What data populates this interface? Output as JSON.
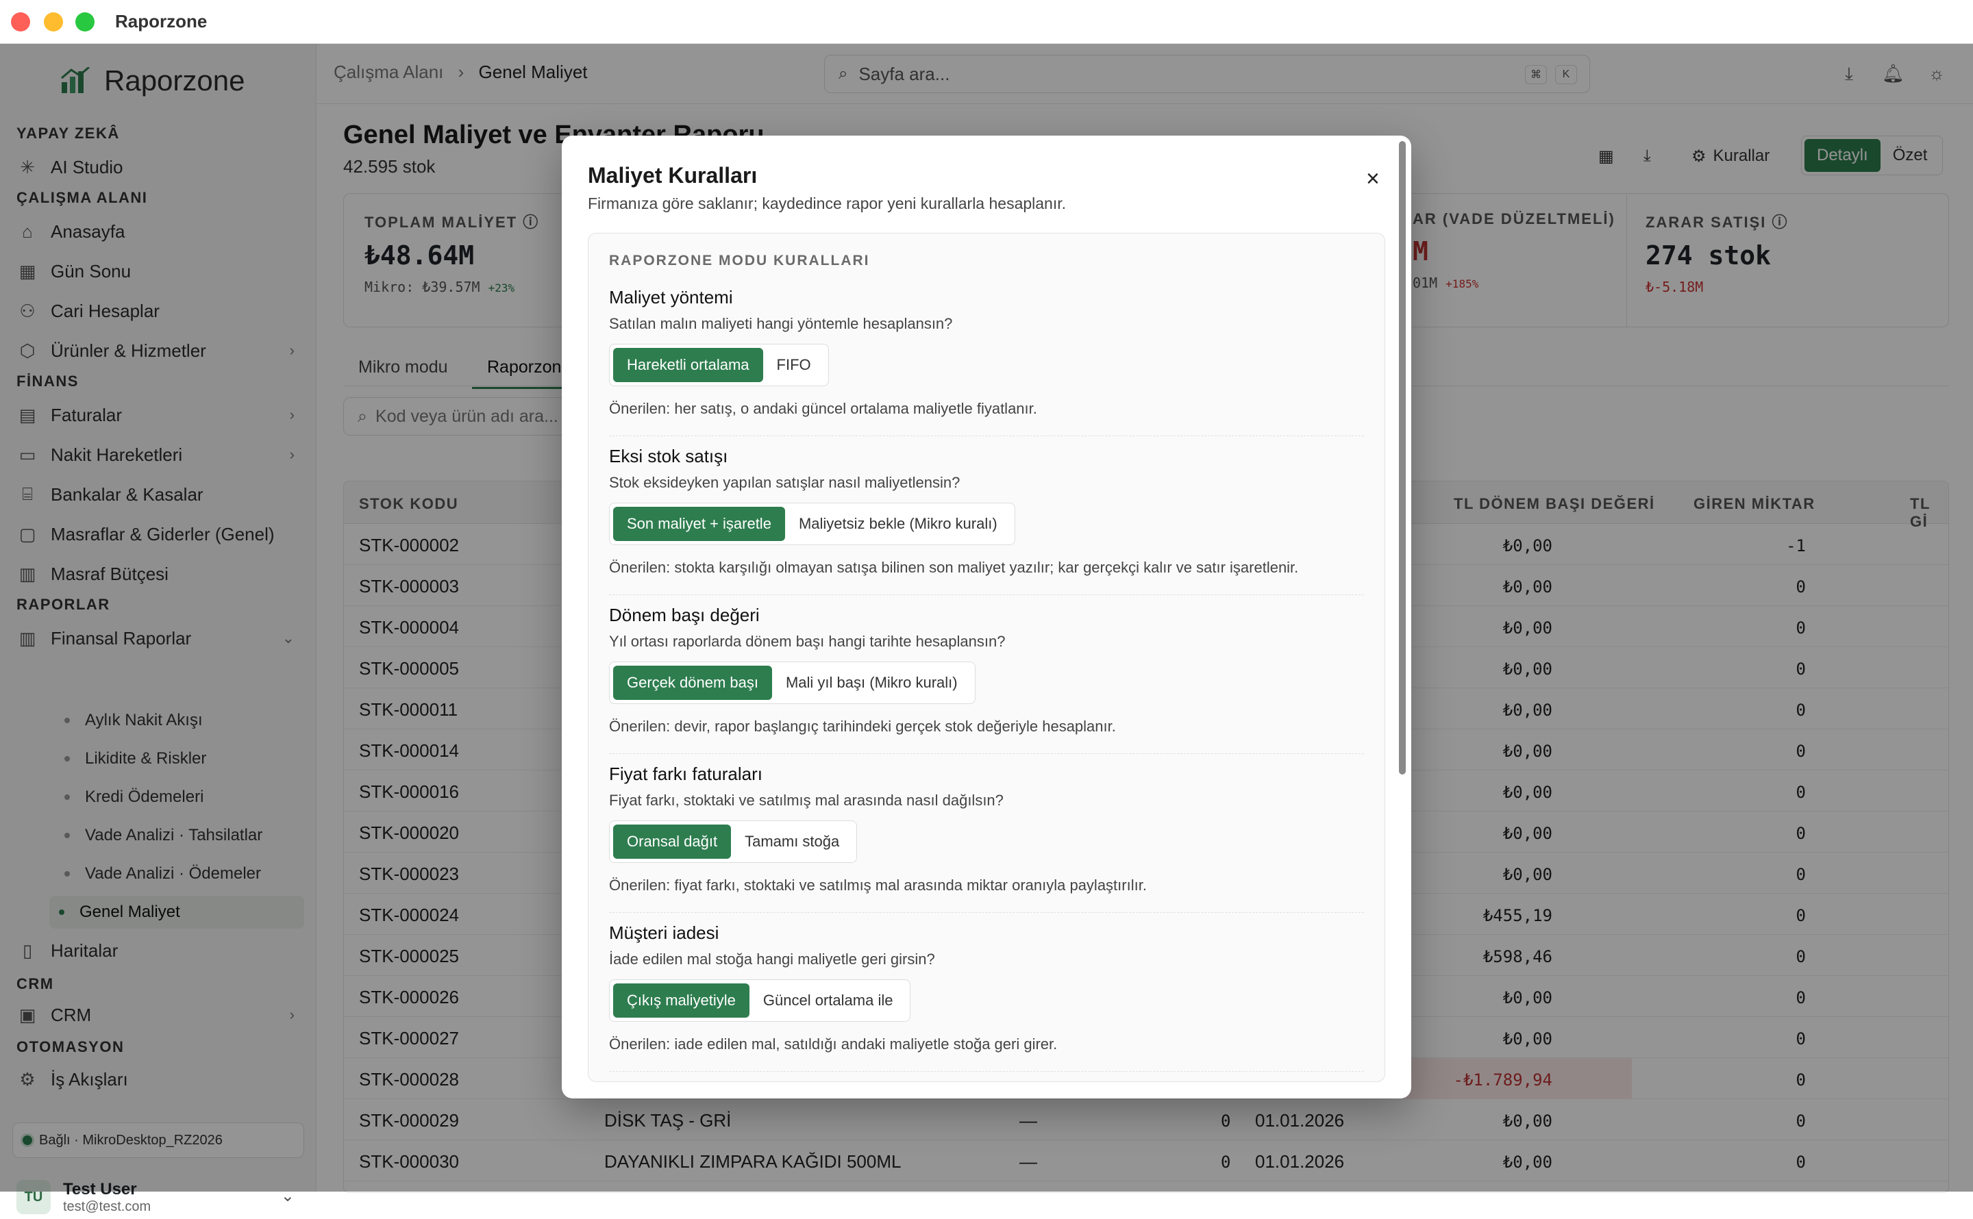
{
  "app": {
    "window_title": "Raporzone",
    "brand": "Raporzone"
  },
  "sidebar": {
    "sections": {
      "ai": "YAPAY ZEKÂ",
      "workspace": "ÇALIŞMA ALANI",
      "finance": "FİNANS",
      "reports": "RAPORLAR",
      "crm": "CRM",
      "automation": "OTOMASYON"
    },
    "items": {
      "ai_studio": "AI Studio",
      "home": "Anasayfa",
      "day_end": "Gün Sonu",
      "accounts": "Cari Hesaplar",
      "products": "Ürünler & Hizmetler",
      "invoices": "Faturalar",
      "cash_moves": "Nakit Hareketleri",
      "banks": "Bankalar & Kasalar",
      "expenses": "Masraflar & Giderler (Genel)",
      "budget": "Masraf Bütçesi",
      "fin_reports": "Finansal Raporlar",
      "maps": "Haritalar",
      "crm": "CRM",
      "workflows": "İş Akışları"
    },
    "subitems": [
      "Aylık Nakit Akışı",
      "Likidite & Riskler",
      "Kredi Ödemeleri",
      "Vade Analizi · Tahsilatlar",
      "Vade Analizi · Ödemeler",
      "Genel Maliyet"
    ],
    "connection": "Bağlı · MikroDesktop_RZ2026",
    "user": {
      "initials": "TU",
      "name": "Test User",
      "email": "test@test.com"
    }
  },
  "topbar": {
    "breadcrumb_root": "Çalışma Alanı",
    "breadcrumb_sep": "›",
    "breadcrumb_current": "Genel Maliyet",
    "search_placeholder": "Sayfa ara...",
    "kbd1": "⌘",
    "kbd2": "K"
  },
  "page": {
    "title": "Genel Maliyet ve Envanter Raporu",
    "subtitle": "42.595 stok",
    "rules_btn": "Kurallar",
    "view_detail": "Detaylı",
    "view_summary": "Özet",
    "cards": {
      "total_cost_label": "TOPLAM MALİYET",
      "total_cost_value": "₺48.64M",
      "total_cost_sub": "Mikro: ₺39.57M",
      "total_cost_delta": "+23%",
      "mid_label": "AR (VADE DÜZELTMELİ)",
      "mid_value": "M",
      "mid_sub": "01M",
      "mid_delta": "+185%",
      "loss_label": "ZARAR SATIŞI",
      "loss_value": "274 stok",
      "loss_sub": "₺-5.18M"
    },
    "tabs": [
      "Mikro modu",
      "Raporzone"
    ],
    "filter_placeholder": "Kod veya ürün adı ara..."
  },
  "table": {
    "headers": {
      "code": "STOK KODU",
      "opening": "TL DÖNEM BAŞI DEĞERİ",
      "in_qty": "GİREN MİKTAR",
      "tl_gi": "TL Gİ"
    },
    "rows": [
      {
        "code": "STK-000002",
        "name": "",
        "dash": "",
        "qty": "",
        "date": "",
        "opening": "₺0,00",
        "in": "-1"
      },
      {
        "code": "STK-000003",
        "name": "",
        "dash": "",
        "qty": "",
        "date": "",
        "opening": "₺0,00",
        "in": "0"
      },
      {
        "code": "STK-000004",
        "name": "",
        "dash": "",
        "qty": "",
        "date": "",
        "opening": "₺0,00",
        "in": "0"
      },
      {
        "code": "STK-000005",
        "name": "",
        "dash": "",
        "qty": "",
        "date": "",
        "opening": "₺0,00",
        "in": "0"
      },
      {
        "code": "STK-000011",
        "name": "",
        "dash": "",
        "qty": "",
        "date": "",
        "opening": "₺0,00",
        "in": "0"
      },
      {
        "code": "STK-000014",
        "name": "",
        "dash": "",
        "qty": "",
        "date": "",
        "opening": "₺0,00",
        "in": "0"
      },
      {
        "code": "STK-000016",
        "name": "",
        "dash": "",
        "qty": "",
        "date": "",
        "opening": "₺0,00",
        "in": "0"
      },
      {
        "code": "STK-000020",
        "name": "",
        "dash": "",
        "qty": "",
        "date": "",
        "opening": "₺0,00",
        "in": "0"
      },
      {
        "code": "STK-000023",
        "name": "",
        "dash": "",
        "qty": "",
        "date": "",
        "opening": "₺0,00",
        "in": "0"
      },
      {
        "code": "STK-000024",
        "name": "",
        "dash": "",
        "qty": "",
        "date": "",
        "opening": "₺455,19",
        "in": "0"
      },
      {
        "code": "STK-000025",
        "name": "",
        "dash": "",
        "qty": "",
        "date": "",
        "opening": "₺598,46",
        "in": "0"
      },
      {
        "code": "STK-000026",
        "name": "",
        "dash": "",
        "qty": "",
        "date": "",
        "opening": "₺0,00",
        "in": "0"
      },
      {
        "code": "STK-000027",
        "name": "",
        "dash": "",
        "qty": "",
        "date": "",
        "opening": "₺0,00",
        "in": "0"
      },
      {
        "code": "STK-000028",
        "name": "",
        "dash": "",
        "qty": "",
        "date": "",
        "opening": "-₺1.789,94",
        "in": "0"
      },
      {
        "code": "STK-000029",
        "name": "DİSK TAŞ - GRİ",
        "dash": "—",
        "qty": "0",
        "date": "01.01.2026",
        "opening": "₺0,00",
        "in": "0"
      },
      {
        "code": "STK-000030",
        "name": "DAYANIKLI ZIMPARA KAĞIDI 500ML",
        "dash": "—",
        "qty": "0",
        "date": "01.01.2026",
        "opening": "₺0,00",
        "in": "0"
      }
    ]
  },
  "modal": {
    "title": "Maliyet Kuralları",
    "description": "Firmanıza göre saklanır; kaydedince rapor yeni kurallarla hesaplanır.",
    "close": "×",
    "section_label": "RAPORZONE MODU KURALLARI",
    "rules": [
      {
        "title": "Maliyet yöntemi",
        "question": "Satılan malın maliyeti hangi yöntemle hesaplansın?",
        "opt_on": "Hareketli ortalama",
        "opt_off": "FIFO",
        "recommendation": "Önerilen: her satış, o andaki güncel ortalama maliyetle fiyatlanır."
      },
      {
        "title": "Eksi stok satışı",
        "question": "Stok eksideyken yapılan satışlar nasıl maliyetlensin?",
        "opt_on": "Son maliyet + işaretle",
        "opt_off": "Maliyetsiz bekle (Mikro kuralı)",
        "recommendation": "Önerilen: stokta karşılığı olmayan satışa bilinen son maliyet yazılır; kar gerçekçi kalır ve satır işaretlenir."
      },
      {
        "title": "Dönem başı değeri",
        "question": "Yıl ortası raporlarda dönem başı hangi tarihte hesaplansın?",
        "opt_on": "Gerçek dönem başı",
        "opt_off": "Mali yıl başı (Mikro kuralı)",
        "recommendation": "Önerilen: devir, rapor başlangıç tarihindeki gerçek stok değeriyle hesaplanır."
      },
      {
        "title": "Fiyat farkı faturaları",
        "question": "Fiyat farkı, stoktaki ve satılmış mal arasında nasıl dağılsın?",
        "opt_on": "Oransal dağıt",
        "opt_off": "Tamamı stoğa",
        "recommendation": "Önerilen: fiyat farkı, stoktaki ve satılmış mal arasında miktar oranıyla paylaştırılır."
      },
      {
        "title": "Müşteri iadesi",
        "question": "İade edilen mal stoğa hangi maliyetle geri girsin?",
        "opt_on": "Çıkış maliyetiyle",
        "opt_off": "Güncel ortalama ile",
        "recommendation": "Önerilen: iade edilen mal, satıldığı andaki maliyetle stoğa geri girer."
      }
    ]
  }
}
